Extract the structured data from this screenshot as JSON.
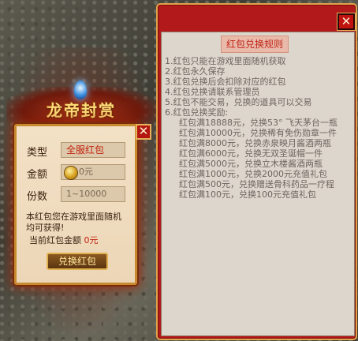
{
  "left": {
    "banner_title": "龙帝封赏",
    "close_icon": "✕",
    "type_label": "类型",
    "type_value": "全服红包",
    "amount_label": "金额",
    "amount_value": "0元",
    "count_label": "份数",
    "count_value": "1~10000",
    "note": "本红包您在游戏里面随机均可获得!",
    "current_label": "当前红包金额",
    "current_value": "0元",
    "exchange_button": "兑换红包"
  },
  "right": {
    "close_icon": "✕",
    "rules_title": "红包兑换规则",
    "rules": [
      "1.红包只能在游戏里面随机获取",
      "2.红包永久保存",
      "3.红包兑换后会扣除对应的红包",
      "4.红包兑换请联系管理员",
      "5.红包不能交易，兑换的道具可以交易",
      "6.红包兑换奖励:"
    ],
    "rewards": [
      "红包满18888元，兑换53° 飞天茅台一瓶",
      "红包满10000元，兑换稀有免伤勋章一件",
      "红包满8000元，兑换赤泉映月酱酒两瓶",
      "红包满6000元，兑换无双圣诞帽一件",
      "红包满5000元，兑换立木楼酱酒两瓶",
      "红包满1000元，兑换2000元充值礼包",
      "红包满500元，兑换赠送骨科药品一疗程",
      "红包满100元，兑换100元充值礼包"
    ]
  },
  "colors": {
    "panel_red": "#b2191a",
    "gold_border": "#e3a24c",
    "accent_red": "#c4230f"
  }
}
